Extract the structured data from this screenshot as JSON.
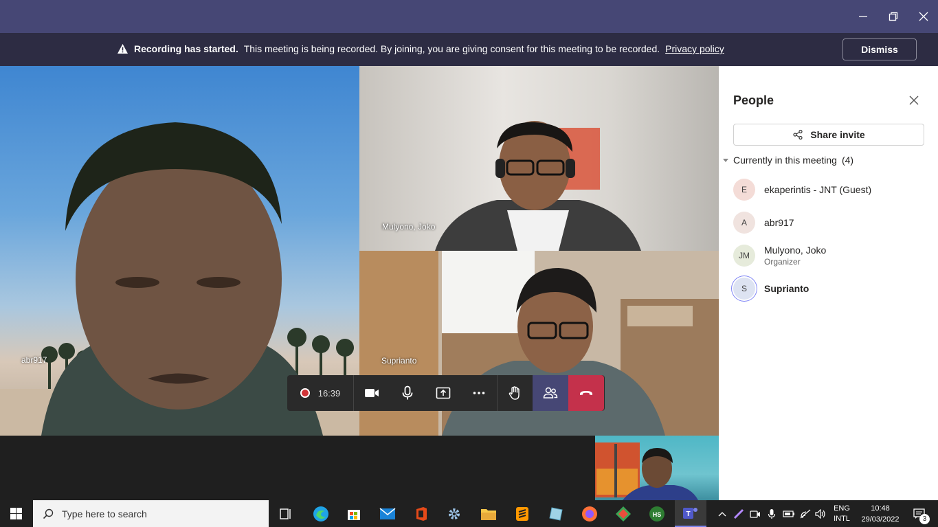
{
  "window": {
    "minimize_icon": "minimize-icon",
    "maximize_icon": "restore-icon",
    "close_icon": "close-icon"
  },
  "banner": {
    "icon": "warning-icon",
    "title": "Recording has started.",
    "message": "This meeting is being recorded. By joining, you are giving consent for this meeting to be recorded.",
    "link": "Privacy policy",
    "dismiss_label": "Dismiss"
  },
  "tiles": [
    {
      "name": "abr917"
    },
    {
      "name": "Mulyono, Joko"
    },
    {
      "name": "Suprianto"
    }
  ],
  "controls": {
    "recording_time": "16:39",
    "items": [
      "camera-icon",
      "microphone-icon",
      "share-screen-icon",
      "more-icon",
      "raise-hand-icon",
      "people-icon",
      "hang-up-icon"
    ]
  },
  "panel": {
    "title": "People",
    "share_label": "Share invite",
    "section_label": "Currently in this meeting",
    "section_count": "(4)",
    "participants": [
      {
        "initials": "E",
        "name": "ekaperintis - JNT (Guest)",
        "role": "",
        "avatar_color": "#f4dcd7"
      },
      {
        "initials": "A",
        "name": "abr917",
        "role": "",
        "avatar_color": "#f0e3df"
      },
      {
        "initials": "JM",
        "name": "Mulyono, Joko",
        "role": "Organizer",
        "avatar_color": "#e6ebdb"
      },
      {
        "initials": "S",
        "name": "Suprianto",
        "role": "",
        "avatar_color": "#dde3f2"
      }
    ]
  },
  "taskbar": {
    "search_placeholder": "Type here to search",
    "language_top": "ENG",
    "language_bottom": "INTL",
    "time": "10:48",
    "date": "29/03/2022",
    "notification_count": "3"
  },
  "colors": {
    "titlebar": "#464775",
    "banner": "#2d2c43",
    "leave": "#c4314b",
    "people_active": "#464775"
  }
}
